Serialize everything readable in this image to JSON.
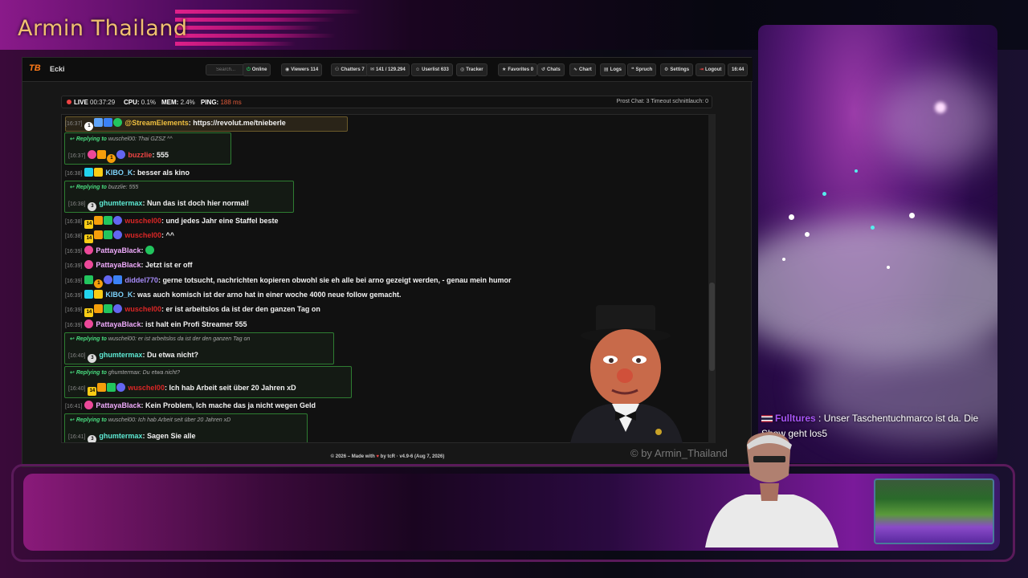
{
  "overlay": {
    "brand_title": "Armin Thailand",
    "watermark": "© by Armin_Thailand"
  },
  "app": {
    "name": "Ecki",
    "search_placeholder": "Search...",
    "nav": [
      {
        "id": "online",
        "icon": "plug-icon",
        "label": "Online"
      },
      {
        "id": "viewers",
        "icon": "eye-icon",
        "label": "Viewers  114"
      },
      {
        "id": "chatters",
        "icon": "users-icon",
        "label": "Chatters  7"
      },
      {
        "id": "messages",
        "icon": "message-icon",
        "label": "141 / 129.294"
      },
      {
        "id": "userlist",
        "icon": "user-icon",
        "label": "Userlist  633"
      },
      {
        "id": "tracker",
        "icon": "radar-icon",
        "label": "Tracker"
      },
      {
        "id": "favorites",
        "icon": "star-icon",
        "label": "Favorites  0"
      },
      {
        "id": "chats",
        "icon": "history-icon",
        "label": "Chats"
      },
      {
        "id": "chart",
        "icon": "chart-icon",
        "label": "Chart"
      },
      {
        "id": "logs",
        "icon": "file-icon",
        "label": "Logs"
      },
      {
        "id": "spruch",
        "icon": "quote-icon",
        "label": "Spruch"
      },
      {
        "id": "settings",
        "icon": "gear-icon",
        "label": "Settings"
      },
      {
        "id": "logout",
        "icon": "logout-icon",
        "label": "Logout"
      },
      {
        "id": "clock",
        "icon": "",
        "label": "16:44"
      }
    ],
    "status": {
      "live_label": "LIVE",
      "live_time": "00:37:29",
      "cpu_label": "CPU:",
      "cpu_value": "0.1%",
      "mem_label": "MEM:",
      "mem_value": "2.4%",
      "ping_label": "PING:",
      "ping_value": "188 ms",
      "right_text": "Prost Chat: 3  Timeout schnittlauch: 0"
    },
    "footer": {
      "left": "© 2026 – Made with",
      "heart": "♥",
      "right": "by tcR · v4.9-6 (Aug 7, 2026)"
    }
  },
  "colors": {
    "streamelements": "#f0c040",
    "buzzlie": "#ef4444",
    "kibo": "#7dd3fc",
    "ghumtermax": "#5eead4",
    "wuschel": "#dc2626",
    "pattaya": "#f0abfc",
    "diddel": "#a78bfa",
    "reply_border": "#2e7d32"
  },
  "chat": {
    "messages": [
      {
        "ts": "[16:37]",
        "user": "@StreamElements",
        "sep": ": ",
        "text": "https://revolut.me/tnieberle"
      },
      {
        "reply_to": "wuschel00: Thai GZSZ ^^",
        "ts": "[16:37]",
        "user": "buzzlie",
        "sep": ": ",
        "text": "555"
      },
      {
        "ts": "[16:38]",
        "user": "KIBO_K",
        "sep": ": ",
        "text": "besser als kino"
      },
      {
        "reply_to": "buzzlie: 555",
        "ts": "[16:38]",
        "user": "ghumtermax",
        "sep": ": ",
        "text": "Nun das ist doch hier normal!"
      },
      {
        "ts": "[16:38]",
        "user": "wuschel00",
        "sep": ": ",
        "text": "und jedes Jahr eine Staffel beste"
      },
      {
        "ts": "[16:38]",
        "user": "wuschel00",
        "sep": ": ",
        "text": "^^"
      },
      {
        "ts": "[16:39]",
        "user": "PattayaBlack",
        "sep": ": ",
        "text": ""
      },
      {
        "ts": "[16:39]",
        "user": "PattayaBlack",
        "sep": ": ",
        "text": "Jetzt ist er off"
      },
      {
        "ts": "[16:39]",
        "user": "diddel770",
        "sep": ": ",
        "text": "gerne totsucht, nachrichten kopieren obwohl sie eh alle bei arno gezeigt werden, - genau mein humor"
      },
      {
        "ts": "[16:39]",
        "user": "KIBO_K",
        "sep": ": ",
        "text": "was auch komisch ist der arno hat in einer woche 4000 neue follow gemacht."
      },
      {
        "ts": "[16:39]",
        "user": "wuschel00",
        "sep": ": ",
        "text": "er ist arbeitslos da ist der den ganzen Tag on"
      },
      {
        "ts": "[16:39]",
        "user": "PattayaBlack",
        "sep": ": ",
        "text": "ist halt ein Profi Streamer 555"
      },
      {
        "reply_to": "wuschel00: er ist arbeitslos da ist der den ganzen Tag on",
        "ts": "[16:40]",
        "user": "ghumtermax",
        "sep": ": ",
        "text": "Du etwa nicht?"
      },
      {
        "reply_to": "ghumtermax: Du etwa nicht?",
        "ts": "[16:40]",
        "user": "wuschel00",
        "sep": ": ",
        "text": "Ich hab Arbeit seit über 20 Jahren xD"
      },
      {
        "ts": "[16:41]",
        "user": "PattayaBlack",
        "sep": ": ",
        "text": "Kein Problem, Ich mache das ja nicht wegen Geld"
      },
      {
        "reply_to": "wuschel00: Ich hab Arbeit seit über 20 Jahren xD",
        "ts": "[16:41]",
        "user": "ghumtermax",
        "sep": ": ",
        "text": "Sagen Sie alle"
      }
    ],
    "replying_label": "Replying to"
  },
  "notice": {
    "user": "Fulltures",
    "sep": " : ",
    "text": "Unser Taschentuchmarco ist da. Die Show geht los5"
  }
}
